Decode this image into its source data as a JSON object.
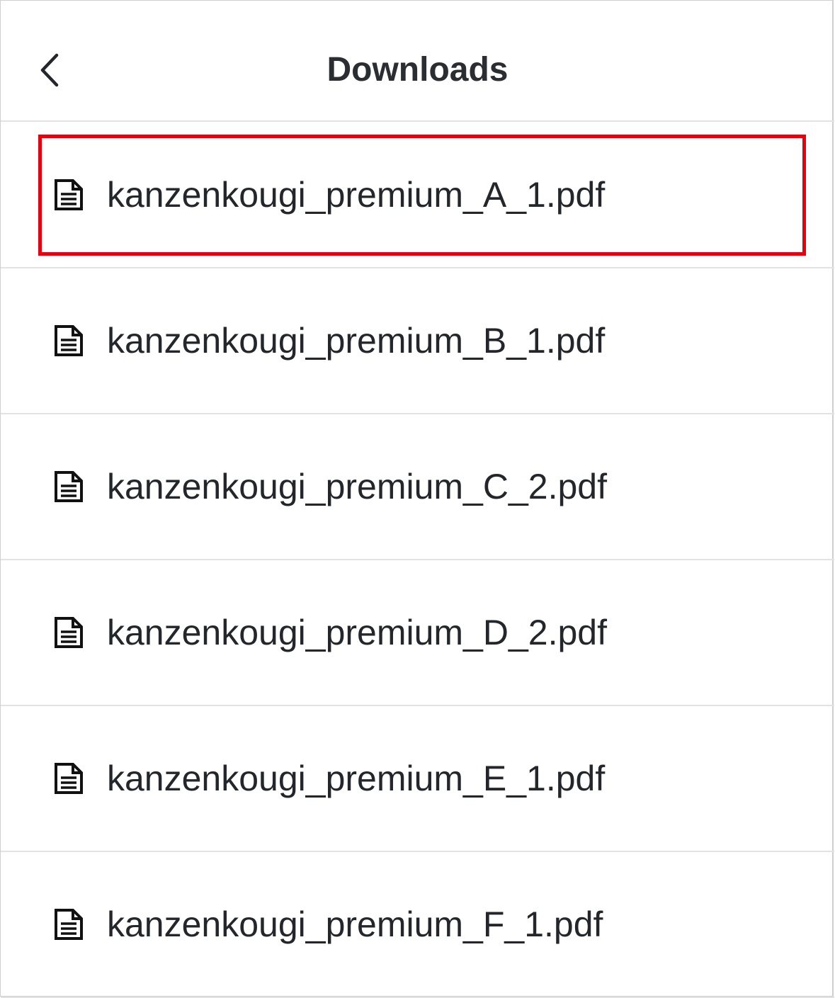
{
  "header": {
    "title": "Downloads",
    "back_icon": "chevron-left-icon"
  },
  "files": [
    {
      "name": "kanzenkougi_premium_A_1.pdf",
      "icon": "document-icon",
      "highlighted": true
    },
    {
      "name": "kanzenkougi_premium_B_1.pdf",
      "icon": "document-icon",
      "highlighted": false
    },
    {
      "name": "kanzenkougi_premium_C_2.pdf",
      "icon": "document-icon",
      "highlighted": false
    },
    {
      "name": "kanzenkougi_premium_D_2.pdf",
      "icon": "document-icon",
      "highlighted": false
    },
    {
      "name": "kanzenkougi_premium_E_1.pdf",
      "icon": "document-icon",
      "highlighted": false
    },
    {
      "name": "kanzenkougi_premium_F_1.pdf",
      "icon": "document-icon",
      "highlighted": false
    }
  ],
  "colors": {
    "highlight_border": "#e8000c",
    "divider": "#e2e2e2",
    "text": "#23262b"
  }
}
